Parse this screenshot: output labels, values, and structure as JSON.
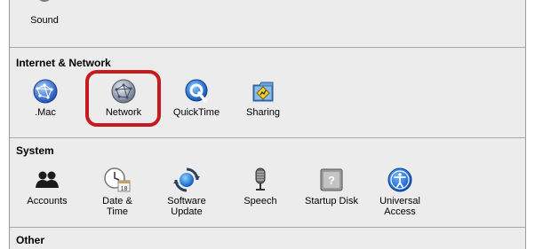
{
  "sections": [
    {
      "id": "hardware",
      "items": [
        {
          "label": "Sound",
          "icon": "sound-icon"
        }
      ]
    },
    {
      "id": "internet",
      "title": "Internet & Network",
      "items": [
        {
          "label": ".Mac",
          "icon": "dotmac-icon"
        },
        {
          "label": "Network",
          "icon": "network-icon"
        },
        {
          "label": "QuickTime",
          "icon": "quicktime-icon"
        },
        {
          "label": "Sharing",
          "icon": "sharing-icon"
        }
      ]
    },
    {
      "id": "system",
      "title": "System",
      "items": [
        {
          "label": "Accounts",
          "icon": "accounts-icon"
        },
        {
          "label": "Date & Time",
          "icon": "date-time-icon",
          "badge": "18"
        },
        {
          "label": "Software\nUpdate",
          "icon": "software-update-icon"
        },
        {
          "label": "Speech",
          "icon": "speech-icon"
        },
        {
          "label": "Startup Disk",
          "icon": "startup-disk-icon"
        },
        {
          "label": "Universal\nAccess",
          "icon": "universal-access-icon"
        }
      ]
    },
    {
      "id": "other",
      "title": "Other",
      "items": []
    }
  ],
  "highlight_color": "#c8191f"
}
